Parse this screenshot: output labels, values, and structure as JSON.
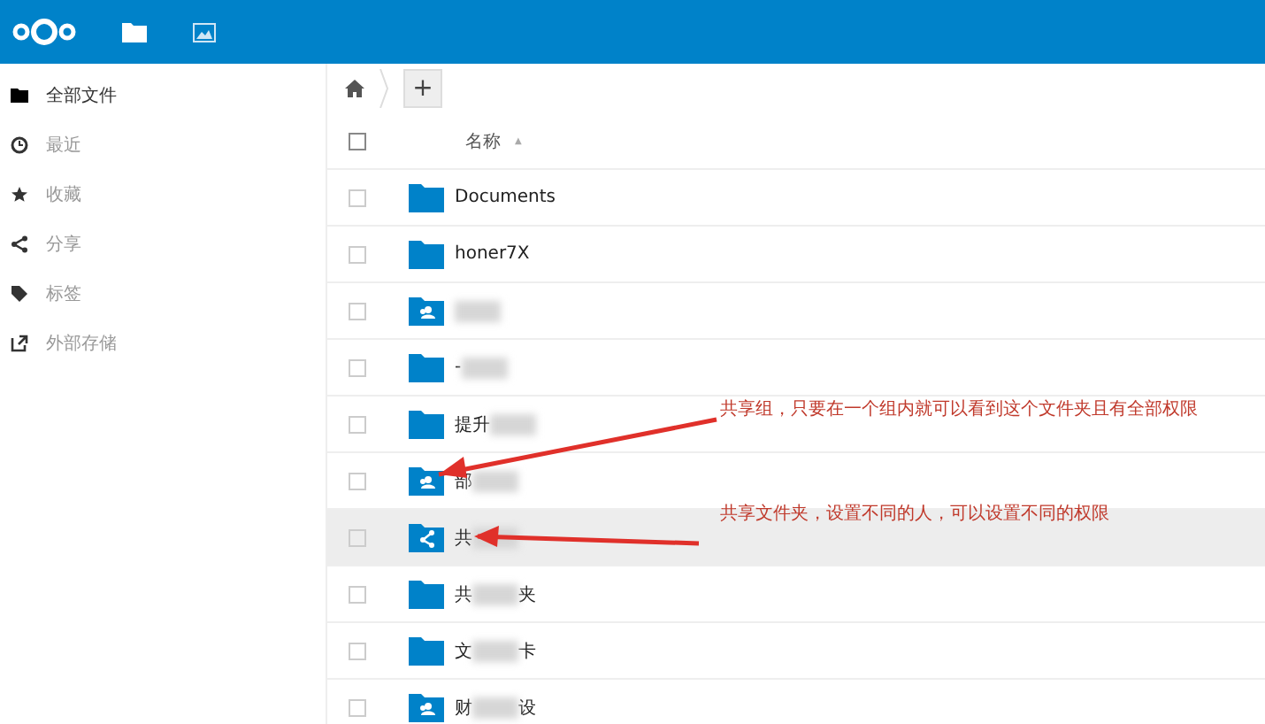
{
  "sidebar": {
    "items": [
      {
        "label": "全部文件",
        "kind": "folder",
        "selected": true
      },
      {
        "label": "最近",
        "kind": "clock",
        "selected": false
      },
      {
        "label": "收藏",
        "kind": "star",
        "selected": false
      },
      {
        "label": "分享",
        "kind": "share",
        "selected": false
      },
      {
        "label": "标签",
        "kind": "tag",
        "selected": false
      },
      {
        "label": "外部存储",
        "kind": "external",
        "selected": false
      }
    ]
  },
  "breadcrumb": {
    "new_button": "+"
  },
  "table": {
    "select_all_checked": false,
    "column": "名称",
    "sort_indicator": "▲",
    "rows": [
      {
        "kind": "folder",
        "name_parts": [
          "Documents"
        ],
        "blurred": false,
        "selected": false
      },
      {
        "kind": "folder",
        "name_parts": [
          "honer7X"
        ],
        "blurred": false,
        "selected": false
      },
      {
        "kind": "group",
        "name_parts": [],
        "blurred": true,
        "selected": false
      },
      {
        "kind": "folder",
        "name_parts": [
          "-"
        ],
        "blurred": true,
        "selected": false
      },
      {
        "kind": "folder",
        "name_parts": [
          "提升"
        ],
        "blurred": true,
        "selected": false
      },
      {
        "kind": "group",
        "name_parts": [
          "部"
        ],
        "blurred": true,
        "selected": false
      },
      {
        "kind": "share",
        "name_parts": [
          "共"
        ],
        "blurred": true,
        "selected": true
      },
      {
        "kind": "folder",
        "name_parts": [
          "共",
          "夹"
        ],
        "blurred": true,
        "selected": false
      },
      {
        "kind": "folder",
        "name_parts": [
          "文",
          "卡"
        ],
        "blurred": true,
        "selected": false
      },
      {
        "kind": "group",
        "name_parts": [
          "财",
          "设"
        ],
        "blurred": true,
        "selected": false
      }
    ]
  },
  "annotations": [
    {
      "text": "共享组，只要在一个组内就可以看到这个文件夹且有全部权限"
    },
    {
      "text": "共享文件夹，设置不同的人，可以设置不同的权限"
    }
  ]
}
